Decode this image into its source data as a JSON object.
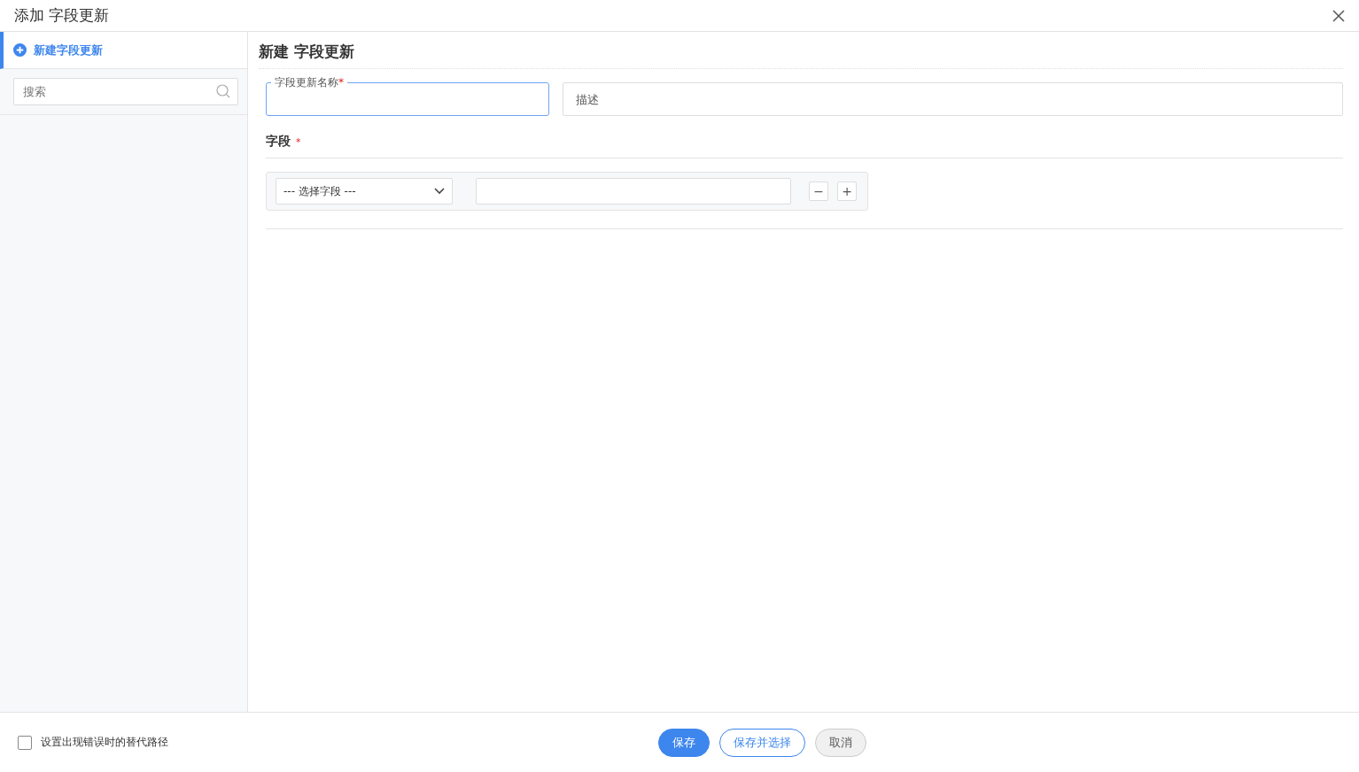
{
  "window": {
    "title": "添加 字段更新"
  },
  "sidebar": {
    "items": [
      {
        "label": "新建字段更新",
        "selected": true
      }
    ],
    "search": {
      "placeholder": "搜索"
    }
  },
  "form": {
    "heading": "新建 字段更新",
    "name_field": {
      "label": "字段更新名称",
      "required_mark": "*",
      "focused": true
    },
    "description_field": {
      "placeholder": "描述"
    },
    "fields_section": {
      "label": "字段",
      "required_mark": "*",
      "rows": [
        {
          "select": "--- 选择字段 ---",
          "remove": "−",
          "add": "+"
        }
      ]
    }
  },
  "footer": {
    "checkbox": {
      "label": "设置出现错误时的替代路径",
      "checked": false
    },
    "buttons": [
      {
        "label": "保存",
        "kind": "primary"
      },
      {
        "label": "保存并选择",
        "kind": "outline"
      },
      {
        "label": "取消",
        "kind": "default"
      }
    ]
  }
}
